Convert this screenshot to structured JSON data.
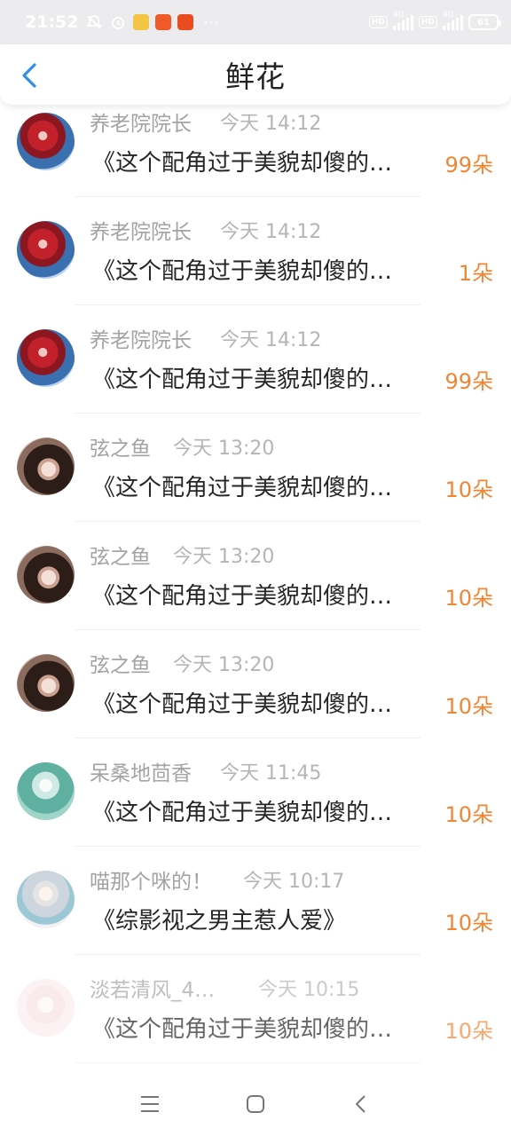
{
  "status_bar": {
    "time": "21:52",
    "network_tags": [
      "HD",
      "HD"
    ],
    "signal_labels": [
      "4G",
      "4G"
    ],
    "battery": "61",
    "more": "···",
    "icons": [
      "bell-off-icon",
      "alarm-icon",
      "app-icon-wechat",
      "app-icon-shop",
      "app-icon-store"
    ]
  },
  "header": {
    "title": "鲜花",
    "back_icon": "chevron-left-icon"
  },
  "colors": {
    "accent": "#f08634",
    "back_arrow": "#2f8fe8",
    "name_gray": "#a3a3a3",
    "text_dark": "#262626"
  },
  "rows": [
    {
      "name": "养老院院长",
      "time": "今天 14:12",
      "book": "《这个配角过于美貌却傻的…",
      "count": "99朵",
      "avatar": "av-red"
    },
    {
      "name": "养老院院长",
      "time": "今天 14:12",
      "book": "《这个配角过于美貌却傻的…",
      "count": "1朵",
      "avatar": "av-red"
    },
    {
      "name": "养老院院长",
      "time": "今天 14:12",
      "book": "《这个配角过于美貌却傻的…",
      "count": "99朵",
      "avatar": "av-red"
    },
    {
      "name": "弦之鱼",
      "time": "今天 13:20",
      "book": "《这个配角过于美貌却傻的…",
      "count": "10朵",
      "avatar": "av-dark"
    },
    {
      "name": "弦之鱼",
      "time": "今天 13:20",
      "book": "《这个配角过于美貌却傻的…",
      "count": "10朵",
      "avatar": "av-dark"
    },
    {
      "name": "弦之鱼",
      "time": "今天 13:20",
      "book": "《这个配角过于美貌却傻的…",
      "count": "10朵",
      "avatar": "av-dark"
    },
    {
      "name": "呆桑地茴香",
      "time": "今天 11:45",
      "book": "《这个配角过于美貌却傻的…",
      "count": "10朵",
      "avatar": "av-green"
    },
    {
      "name": "喵那个咪的！",
      "time": "今天 10:17",
      "book": "《综影视之男主惹人爱》",
      "count": "10朵",
      "avatar": "av-pastel"
    },
    {
      "name": "淡若清风_4…",
      "time": "今天 10:15",
      "book": "《这个配角过于美貌却傻的…",
      "count": "10朵",
      "avatar": "av-pink"
    }
  ],
  "nav": {
    "menu_icon": "menu-icon",
    "home_icon": "home-square-icon",
    "back_icon": "back-triangle-icon"
  }
}
